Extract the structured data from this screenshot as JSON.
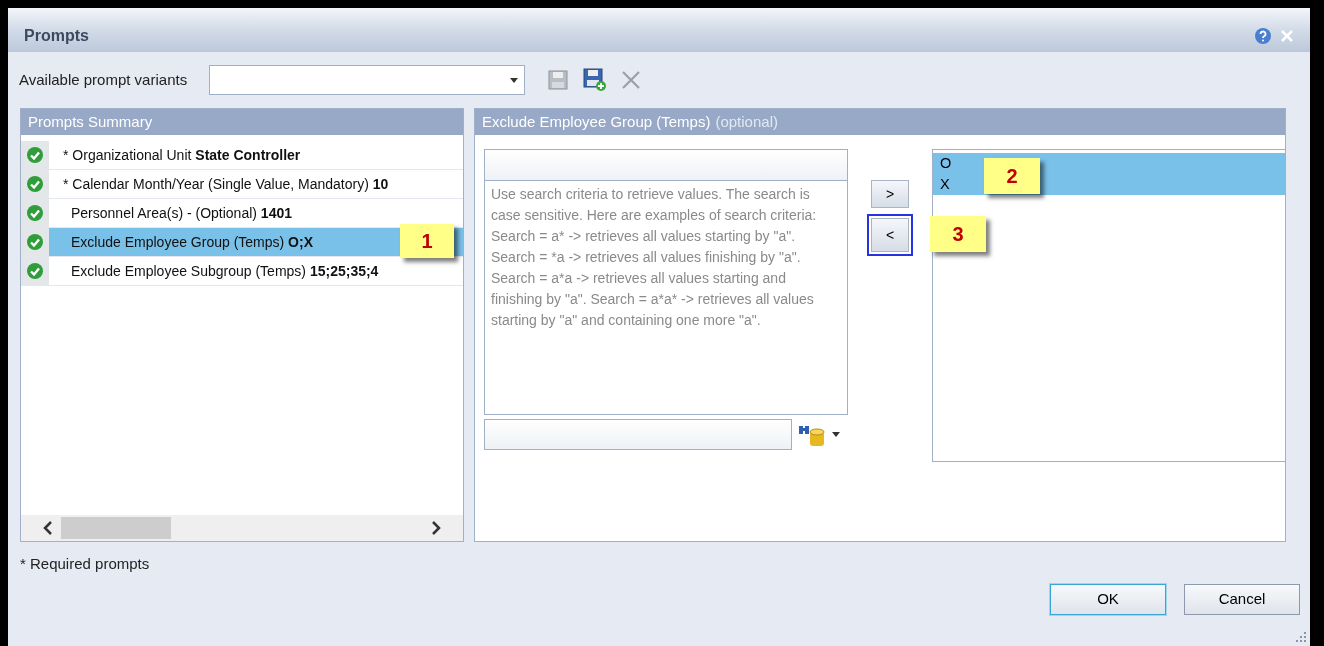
{
  "window": {
    "title": "Prompts"
  },
  "variants": {
    "label": "Available prompt variants"
  },
  "summary": {
    "title": "Prompts Summary",
    "items": [
      {
        "text": "* Organizational Unit **State Controller**",
        "selected": false
      },
      {
        "text": "* Calendar Month/Year (Single Value, Mandatory) **10**",
        "selected": false
      },
      {
        "text": "Personnel Area(s) - (Optional) **1401**",
        "selected": false
      },
      {
        "text": "Exclude Employee Group (Temps) **O;X**",
        "selected": true
      },
      {
        "text": "Exclude Employee Subgroup (Temps) **15;25;35;4**",
        "selected": false
      }
    ]
  },
  "detail": {
    "title": "Exclude Employee Group (Temps)",
    "note": "(optional)",
    "hint": "Use search criteria to retrieve values. The search is case sensitive. Here are examples of search criteria: Search = a* -> retrieves all values starting by \"a\". Search = *a -> retrieves all values finishing by \"a\". Search = a*a -> retrieves all values starting and finishing by \"a\". Search = a*a* -> retrieves all values starting by \"a\" and containing one more \"a\".",
    "add_button": ">",
    "remove_button": "<",
    "selected_values": [
      {
        "text": "O",
        "selected": true
      },
      {
        "text": "X",
        "selected": true
      }
    ]
  },
  "callouts": [
    "1",
    "2",
    "3"
  ],
  "footnote": "* Required prompts",
  "buttons": [
    "OK",
    "Cancel"
  ]
}
